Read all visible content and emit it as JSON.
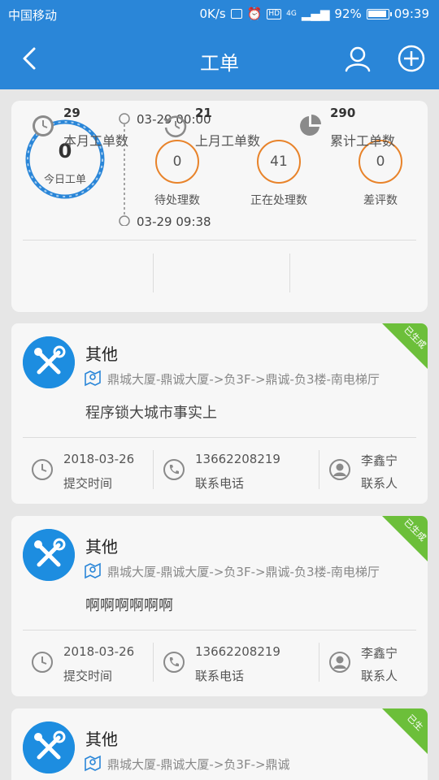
{
  "status_bar": {
    "carrier": "中国移动",
    "speed": "0K/s",
    "hd_badge": "HD",
    "network": "4G",
    "battery": "92%",
    "time": "09:39"
  },
  "app_bar": {
    "title": "工单"
  },
  "summary": {
    "today_count": "0",
    "today_label": "今日工单",
    "time_start": "03-29 00:00",
    "time_end": "03-29 09:38",
    "stats": [
      {
        "value": "0",
        "label": "待处理数"
      },
      {
        "value": "41",
        "label": "正在处理数"
      },
      {
        "value": "0",
        "label": "差评数"
      }
    ],
    "totals": [
      {
        "value": "29",
        "label": "本月工单数",
        "icon": "clock-icon"
      },
      {
        "value": "21",
        "label": "上月工单数",
        "icon": "history-icon"
      },
      {
        "value": "290",
        "label": "累计工单数",
        "icon": "pie-chart-icon"
      }
    ]
  },
  "orders": [
    {
      "type": "其他",
      "location": "鼎城大厦-鼎诚大厦->负3F->鼎诚-负3楼-南电梯厅",
      "description": "程序锁大城市事实上",
      "badge": "已生成",
      "date": "2018-03-26",
      "date_label": "提交时间",
      "phone": "13662208219",
      "phone_label": "联系电话",
      "contact": "李鑫宁",
      "contact_label": "联系人"
    },
    {
      "type": "其他",
      "location": "鼎城大厦-鼎诚大厦->负3F->鼎诚-负3楼-南电梯厅",
      "description": "啊啊啊啊啊啊",
      "badge": "已生成",
      "date": "2018-03-26",
      "date_label": "提交时间",
      "phone": "13662208219",
      "phone_label": "联系电话",
      "contact": "李鑫宁",
      "contact_label": "联系人"
    },
    {
      "type": "其他",
      "location": "鼎城大厦-鼎诚大厦->负3F->鼎诚",
      "badge": "已生"
    }
  ],
  "colors": {
    "primary": "#2a86d8",
    "accent_orange": "#e8832a",
    "badge_green": "#6cbf3a",
    "avatar_blue": "#1d8de0"
  }
}
